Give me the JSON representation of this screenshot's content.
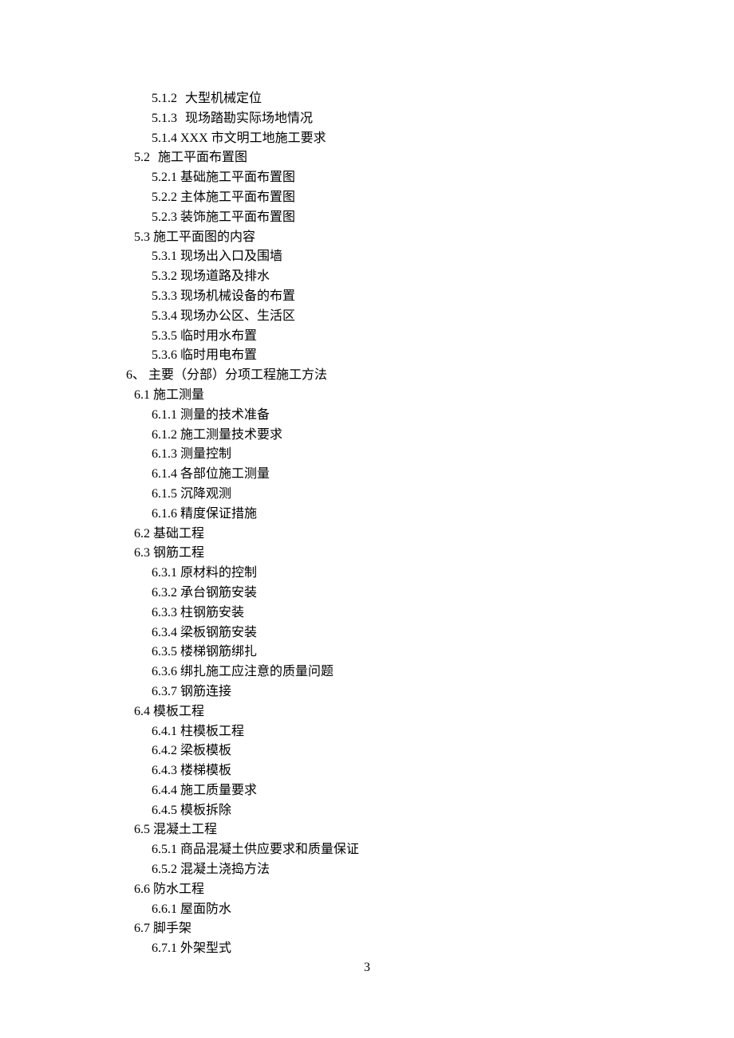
{
  "page_number": "3",
  "toc": [
    {
      "level": 3,
      "num": "5.1.2",
      "gap": "wide",
      "text": "大型机械定位"
    },
    {
      "level": 3,
      "num": "5.1.3",
      "gap": "wide",
      "text": "现场踏勘实际场地情况"
    },
    {
      "level": 3,
      "num": "5.1.4",
      "gap": "narrow",
      "text": "XXX 市文明工地施工要求"
    },
    {
      "level": 2,
      "num": "5.2",
      "gap": "wide",
      "text": "施工平面布置图"
    },
    {
      "level": 3,
      "num": "5.2.1",
      "gap": "narrow",
      "text": "基础施工平面布置图"
    },
    {
      "level": 3,
      "num": "5.2.2",
      "gap": "narrow",
      "text": "主体施工平面布置图"
    },
    {
      "level": 3,
      "num": "5.2.3",
      "gap": "narrow",
      "text": "装饰施工平面布置图"
    },
    {
      "level": 2,
      "num": "5.3",
      "gap": "narrow",
      "text": "施工平面图的内容"
    },
    {
      "level": 3,
      "num": "5.3.1",
      "gap": "narrow",
      "text": "现场出入口及围墙"
    },
    {
      "level": 3,
      "num": "5.3.2",
      "gap": "narrow",
      "text": "现场道路及排水"
    },
    {
      "level": 3,
      "num": "5.3.3",
      "gap": "narrow",
      "text": "现场机械设备的布置"
    },
    {
      "level": 3,
      "num": "5.3.4",
      "gap": "narrow",
      "text": "现场办公区、生活区"
    },
    {
      "level": 3,
      "num": "5.3.5",
      "gap": "narrow",
      "text": "临时用水布置"
    },
    {
      "level": 3,
      "num": "5.3.6",
      "gap": "narrow",
      "text": "临时用电布置"
    },
    {
      "level": 1,
      "num": "6、",
      "gap": "narrow",
      "text": "主要（分部）分项工程施工方法"
    },
    {
      "level": 2,
      "num": "6.1",
      "gap": "narrow",
      "text": "施工测量"
    },
    {
      "level": 3,
      "num": "6.1.1",
      "gap": "narrow",
      "text": "测量的技术准备"
    },
    {
      "level": 3,
      "num": "6.1.2",
      "gap": "narrow",
      "text": "施工测量技术要求"
    },
    {
      "level": 3,
      "num": "6.1.3",
      "gap": "narrow",
      "text": "测量控制"
    },
    {
      "level": 3,
      "num": "6.1.4",
      "gap": "narrow",
      "text": "各部位施工测量"
    },
    {
      "level": 3,
      "num": "6.1.5",
      "gap": "narrow",
      "text": "沉降观测"
    },
    {
      "level": 3,
      "num": "6.1.6",
      "gap": "narrow",
      "text": "精度保证措施"
    },
    {
      "level": 2,
      "num": "6.2",
      "gap": "narrow",
      "text": "基础工程"
    },
    {
      "level": 2,
      "num": "6.3",
      "gap": "narrow",
      "text": "钢筋工程"
    },
    {
      "level": 3,
      "num": "6.3.1",
      "gap": "narrow",
      "text": "原材料的控制"
    },
    {
      "level": 3,
      "num": "6.3.2",
      "gap": "narrow",
      "text": "承台钢筋安装"
    },
    {
      "level": 3,
      "num": "6.3.3",
      "gap": "narrow",
      "text": "柱钢筋安装"
    },
    {
      "level": 3,
      "num": "6.3.4",
      "gap": "narrow",
      "text": "梁板钢筋安装"
    },
    {
      "level": 3,
      "num": "6.3.5",
      "gap": "narrow",
      "text": "楼梯钢筋绑扎"
    },
    {
      "level": 3,
      "num": "6.3.6",
      "gap": "narrow",
      "text": "绑扎施工应注意的质量问题"
    },
    {
      "level": 3,
      "num": "6.3.7",
      "gap": "narrow",
      "text": "钢筋连接"
    },
    {
      "level": 2,
      "num": "6.4",
      "gap": "narrow",
      "text": "模板工程"
    },
    {
      "level": 3,
      "num": "6.4.1",
      "gap": "narrow",
      "text": "柱模板工程"
    },
    {
      "level": 3,
      "num": "6.4.2",
      "gap": "narrow",
      "text": "梁板模板"
    },
    {
      "level": 3,
      "num": "6.4.3",
      "gap": "narrow",
      "text": "楼梯模板"
    },
    {
      "level": 3,
      "num": "6.4.4",
      "gap": "narrow",
      "text": "施工质量要求"
    },
    {
      "level": 3,
      "num": "6.4.5",
      "gap": "narrow",
      "text": "模板拆除"
    },
    {
      "level": 2,
      "num": "6.5",
      "gap": "narrow",
      "text": "混凝土工程"
    },
    {
      "level": 3,
      "num": "6.5.1",
      "gap": "narrow",
      "text": "商品混凝土供应要求和质量保证"
    },
    {
      "level": 3,
      "num": "6.5.2",
      "gap": "narrow",
      "text": "混凝土浇捣方法"
    },
    {
      "level": 2,
      "num": "6.6",
      "gap": "narrow",
      "text": "防水工程"
    },
    {
      "level": 3,
      "num": "6.6.1",
      "gap": "narrow",
      "text": "屋面防水"
    },
    {
      "level": 2,
      "num": "6.7",
      "gap": "narrow",
      "text": "脚手架"
    },
    {
      "level": 3,
      "num": "6.7.1",
      "gap": "narrow",
      "text": "外架型式"
    }
  ]
}
